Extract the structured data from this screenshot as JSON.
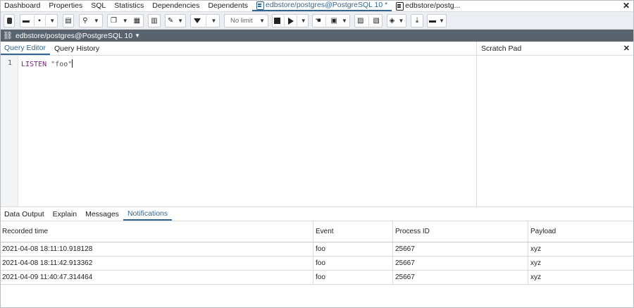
{
  "top_tabs": [
    {
      "label": "Dashboard"
    },
    {
      "label": "Properties"
    },
    {
      "label": "SQL"
    },
    {
      "label": "Statistics"
    },
    {
      "label": "Dependencies"
    },
    {
      "label": "Dependents"
    },
    {
      "label": "edbstore/postgres@PostgreSQL 10 *",
      "active": true,
      "icon": "query-tool-icon"
    },
    {
      "label": "edbstore/postg...",
      "icon": "query-tool-icon"
    }
  ],
  "toolbar": {
    "limit_select": "No limit"
  },
  "connection": {
    "label": "edbstore/postgres@PostgreSQL 10"
  },
  "editor_tabs": [
    {
      "label": "Query Editor",
      "active": true
    },
    {
      "label": "Query History"
    }
  ],
  "scratch_pad": {
    "title": "Scratch Pad"
  },
  "editor": {
    "line_number": "1",
    "keyword": "LISTEN",
    "argument": "\"foo\""
  },
  "output_tabs": [
    {
      "label": "Data Output"
    },
    {
      "label": "Explain"
    },
    {
      "label": "Messages"
    },
    {
      "label": "Notifications",
      "active": true
    }
  ],
  "results": {
    "columns": [
      "Recorded time",
      "Event",
      "Process ID",
      "Payload"
    ],
    "rows": [
      [
        "2021-04-08 18:11:10.918128",
        "foo",
        "25667",
        "xyz"
      ],
      [
        "2021-04-08 18:11:42.913362",
        "foo",
        "25667",
        "xyz"
      ],
      [
        "2021-04-09 11:40:47.314464",
        "foo",
        "25667",
        "xyz"
      ]
    ]
  },
  "colors": {
    "accent": "#326690",
    "connection_bar": "#58636e",
    "toolbar_bg": "#ebeef3"
  }
}
